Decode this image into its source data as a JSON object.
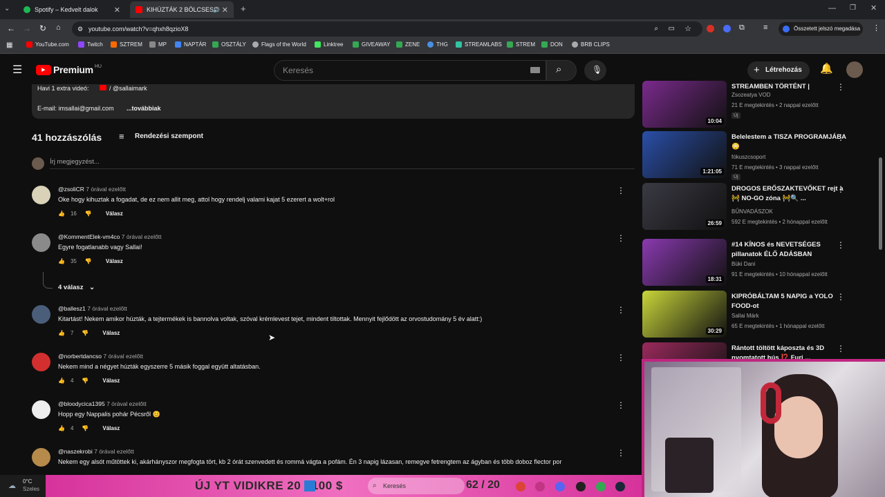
{
  "browser": {
    "tabs": [
      {
        "label": "Spotify – Kedvelt dalok"
      },
      {
        "label": "KIHÚZTÁK 2 BÖLCSESSÉGF"
      }
    ],
    "url": "youtube.com/watch?v=qhxh8qzioX8",
    "profile_label": "Összetett jelszó megadása",
    "bookmarks": [
      "YouTube.com",
      "Twitch",
      "SZTREM",
      "MP",
      "NAPTÁR",
      "OSZTÁLY",
      "Flags of the World",
      "Linktree",
      "GIVEAWAY",
      "ZENE",
      "THG",
      "STREAMLABS",
      "STREM",
      "DON",
      "BRB CLIPS"
    ]
  },
  "youtube": {
    "logo": "Premium",
    "logo_region": "HU",
    "search_placeholder": "Keresés",
    "create_label": "Létrehozás"
  },
  "description": {
    "line1_prefix": "Havi 1 extra videó:",
    "line1_link": "/ @sallaimark",
    "line2": "E-mail: imsallai@gmail.com",
    "more": "...továbbiak"
  },
  "comments_header": {
    "count": "41 hozzászólás",
    "sort_label": "Rendezési szempont",
    "add_placeholder": "Írj megjegyzést..."
  },
  "comments": [
    {
      "user": "@zsoliCR",
      "time": "7 órával ezelőtt",
      "text": "Oke hogy kihuztak a fogadat, de ez nem allit meg, attol hogy rendelj valami kajat 5 ezerert a wolt+rol",
      "likes": "16",
      "reply": "Válasz"
    },
    {
      "user": "@KommentElek-vm4co",
      "time": "7 órával ezelőtt",
      "text": "Egyre fogatlanabb vagy Sallai!",
      "likes": "35",
      "reply": "Válasz",
      "replies_label": "4 válasz"
    },
    {
      "user": "@ballesz1",
      "time": "7 órával ezelőtt",
      "text": "Kitartást! Nekem amikor húzták, a tejtermékek is bannolva voltak, szóval krémlevest tejet, mindent tiltottak. Mennyit fejlődött az orvostudomány 5 év alatt:)",
      "likes": "7",
      "reply": "Válasz"
    },
    {
      "user": "@norbertdancso",
      "time": "7 órával ezelőtt",
      "text": "Nekem mind a négyet húzták egyszerre 5 másik foggal együtt altatásban.",
      "likes": "4",
      "reply": "Válasz"
    },
    {
      "user": "@bloodycica1395",
      "time": "7 órával ezelőtt",
      "text": "Hopp egy Nappalis pohár Pécsről 😊",
      "likes": "4",
      "reply": "Válasz"
    },
    {
      "user": "@naszekrobi",
      "time": "7 órával ezelőtt",
      "text": "Nekem egy alsót műtöttek ki, akárhányszor megfogta tört, kb 2 órát szenvedett és rommá vágta a pofám. Én 3 napig lázasan, remegve fetrengtem az ágyban és több doboz flector por"
    }
  ],
  "related": [
    {
      "title": "STREAMBEN TÖRTÉNT |",
      "channel": "Zsozeatya VOD",
      "meta": "21 E megtekintés • 2 nappal ezelőtt",
      "duration": "10:04",
      "badge": "Új",
      "thumb_color": "#7a2a8c"
    },
    {
      "title": "Belelestem a TISZA PROGRAMJÁBA 😳",
      "channel": "fókuszcsoport",
      "meta": "71 E megtekintés • 3 nappal ezelőtt",
      "duration": "1:21:05",
      "badge": "Új",
      "thumb_color": "#2a4fa8"
    },
    {
      "title": "DROGOS ERŐSZAKTEVŐKET rejt a 🚧 NO-GO zóna 🚧🔍 ...",
      "channel": "BŰNVADÁSZOK",
      "meta": "592 E megtekintés • 2 hónappal ezelőtt",
      "duration": "26:59",
      "thumb_color": "#3a3a44"
    },
    {
      "title": "#14 KÍNOS és NEVETSÉGES pillanatok ÉLŐ ADÁSBAN",
      "channel": "Büki Dani",
      "meta": "91 E megtekintés • 10 hónappal ezelőtt",
      "duration": "18:31",
      "thumb_color": "#8a3ab0"
    },
    {
      "title": "KIPRÓBÁLTAM 5 NAPIG a YOLO FOOD-ot",
      "channel": "Sallai Márk",
      "meta": "65 E megtekintés • 1 hónappal ezelőtt",
      "duration": "30:29",
      "thumb_color": "#c9d63a"
    },
    {
      "title": "Rántott töltött káposzta és 3D nyomtatott hús ⁉️ Furi ...",
      "thumb_color": "#9a2a5c"
    }
  ],
  "taskbar": {
    "weather_temp": "0°C",
    "weather_desc": "Szeles",
    "ticker": "ÚJ YT VIDIKRE  20 / 100 $",
    "search": "Keresés",
    "counter": "62 / 20"
  },
  "colors": {
    "accent_red": "#ff0000",
    "ticker_pink": "#e94aaf"
  }
}
